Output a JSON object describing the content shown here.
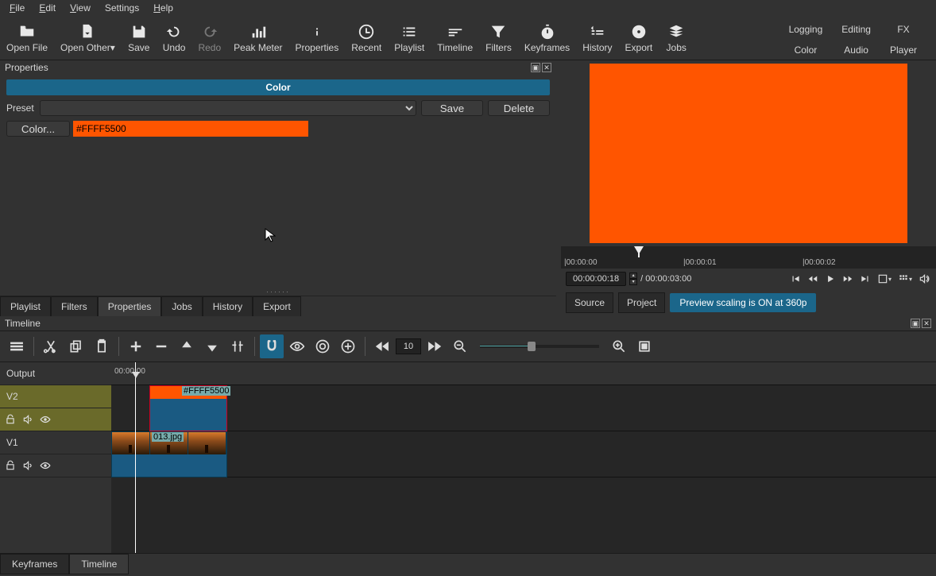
{
  "menu": {
    "file": "File",
    "edit": "Edit",
    "view": "View",
    "settings": "Settings",
    "help": "Help"
  },
  "toolbar": {
    "open_file": "Open File",
    "open_other": "Open Other",
    "save": "Save",
    "undo": "Undo",
    "redo": "Redo",
    "peak_meter": "Peak Meter",
    "properties": "Properties",
    "recent": "Recent",
    "playlist": "Playlist",
    "timeline": "Timeline",
    "filters": "Filters",
    "keyframes": "Keyframes",
    "history": "History",
    "export": "Export",
    "jobs": "Jobs"
  },
  "layouts": {
    "logging": "Logging",
    "editing": "Editing",
    "fx": "FX",
    "color": "Color",
    "audio": "Audio",
    "player": "Player"
  },
  "properties": {
    "title": "Properties",
    "header": "Color",
    "preset_label": "Preset",
    "save_btn": "Save",
    "delete_btn": "Delete",
    "color_btn": "Color...",
    "color_value": "#FFFF5500"
  },
  "left_tabs": {
    "playlist": "Playlist",
    "filters": "Filters",
    "properties": "Properties",
    "jobs": "Jobs",
    "history": "History",
    "export": "Export"
  },
  "player": {
    "time_0": "|00:00:00",
    "time_1": "|00:00:01",
    "time_2": "|00:00:02",
    "current_tc": "00:00:00:18",
    "total_tc": "/ 00:00:03:00",
    "source_tab": "Source",
    "project_tab": "Project",
    "preview_notice": "Preview scaling is ON at 360p"
  },
  "timeline": {
    "title": "Timeline",
    "zoom_value": "10",
    "ruler_0": "00:00:00",
    "output": "Output",
    "v2": "V2",
    "v1": "V1",
    "clip_v2_label": "#FFFF5500",
    "clip_v1_label": "013.jpg"
  },
  "bottom_tabs": {
    "keyframes": "Keyframes",
    "timeline": "Timeline"
  }
}
